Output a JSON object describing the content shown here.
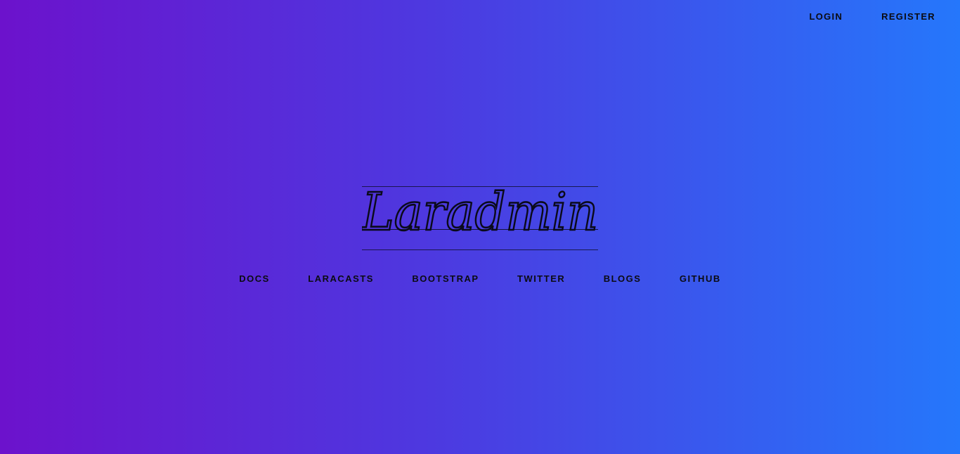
{
  "top_nav": {
    "login": "LOGIN",
    "register": "REGISTER"
  },
  "logo": {
    "text": "Laradmin"
  },
  "links": [
    {
      "label": "DOCS"
    },
    {
      "label": "LARACASTS"
    },
    {
      "label": "BOOTSTRAP"
    },
    {
      "label": "TWITTER"
    },
    {
      "label": "BLOGS"
    },
    {
      "label": "GITHUB"
    }
  ],
  "colors": {
    "gradient_start": "#6c12cc",
    "gradient_end": "#2577fb",
    "text": "#0b0b12"
  }
}
